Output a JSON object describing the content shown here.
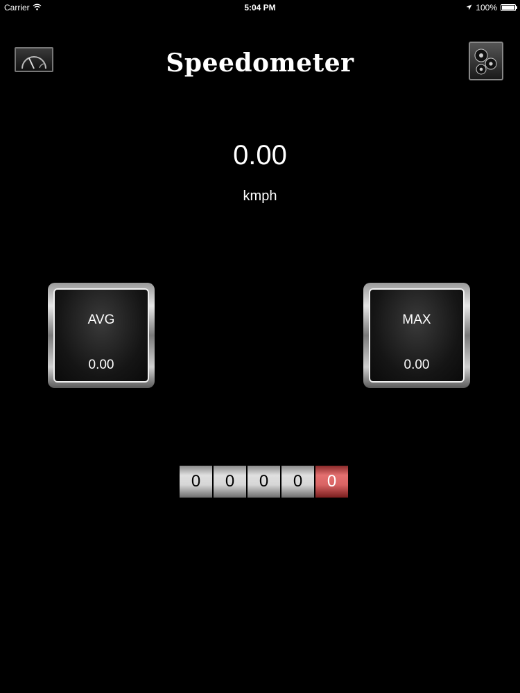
{
  "status_bar": {
    "carrier": "Carrier",
    "time": "5:04 PM",
    "battery": "100%",
    "icons": [
      "wifi-icon",
      "location-arrow-icon",
      "battery-icon"
    ]
  },
  "header": {
    "title": "Speedometer",
    "left_icon": "speedometer-gauge-icon",
    "right_icon": "settings-gears-icon"
  },
  "speed": {
    "value": "0.00",
    "unit": "kmph"
  },
  "stats": {
    "avg": {
      "label": "AVG",
      "value": "0.00"
    },
    "max": {
      "label": "MAX",
      "value": "0.00"
    }
  },
  "odometer": {
    "digits": [
      "0",
      "0",
      "0",
      "0",
      "0"
    ]
  },
  "colors": {
    "background": "#000000",
    "text": "#ffffff",
    "odometer_accent": "#d96464"
  }
}
